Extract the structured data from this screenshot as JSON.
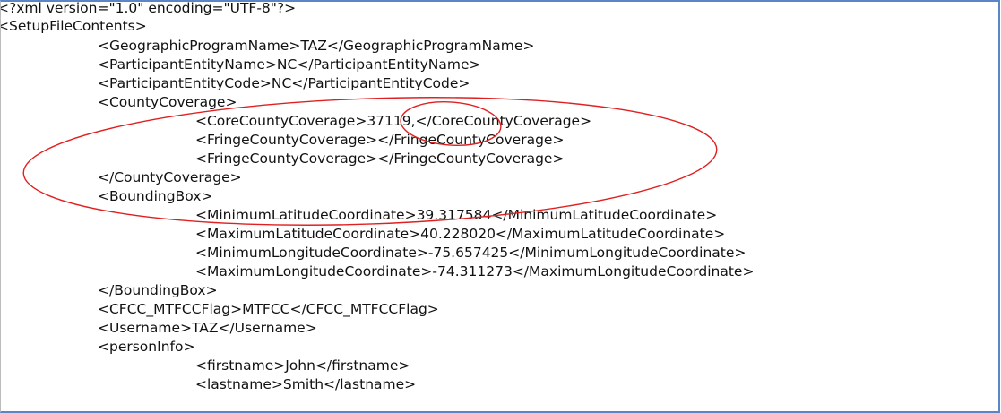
{
  "editor": {
    "lines": [
      "<?xml version=\"1.0\" encoding=\"UTF-8\"?>",
      "<SetupFileContents>",
      "<GeographicProgramName>TAZ</GeographicProgramName>",
      "<ParticipantEntityName>NC</ParticipantEntityName>",
      "<ParticipantEntityCode>NC</ParticipantEntityCode>",
      "<CountyCoverage>",
      "<CoreCountyCoverage>37119,</CoreCountyCoverage>",
      "<FringeCountyCoverage></FringeCountyCoverage>",
      "<FringeCountyCoverage></FringeCountyCoverage>",
      "</CountyCoverage>",
      "<BoundingBox>",
      "<MinimumLatitudeCoordinate>39.317584</MinimumLatitudeCoordinate>",
      "<MaximumLatitudeCoordinate>40.228020</MaximumLatitudeCoordinate>",
      "<MinimumLongitudeCoordinate>-75.657425</MinimumLongitudeCoordinate>",
      "<MaximumLongitudeCoordinate>-74.311273</MaximumLongitudeCoordinate>",
      "</BoundingBox>",
      "<CFCC_MTFCCFlag>MTFCC</CFCC_MTFCCFlag>",
      "<Username>TAZ</Username>",
      "<personInfo>",
      "<firstname>John</firstname>",
      "<lastname>Smith</lastname>"
    ]
  },
  "colors": {
    "annotation_stroke": "#e02020",
    "frame_border": "#5a86c8",
    "text": "#111111"
  }
}
